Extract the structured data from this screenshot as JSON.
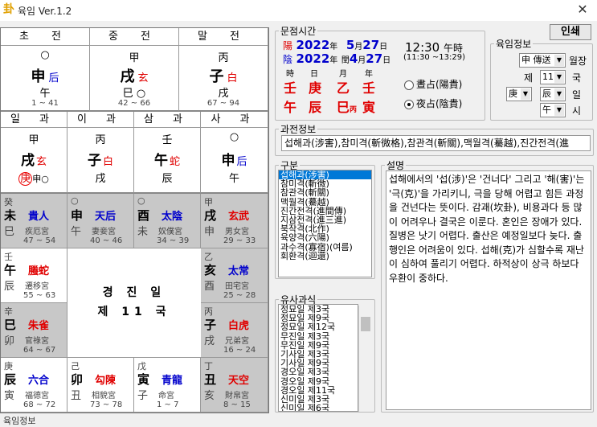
{
  "window": {
    "title": "육임 Ver.1.2",
    "close": "✕"
  },
  "top3": {
    "headers": [
      "초 전",
      "중 전",
      "말 전"
    ],
    "cells": [
      {
        "top": "○",
        "mid": "申",
        "midSmall": "后",
        "smallColor": "blue",
        "low": "午",
        "range": "1 ~ 41"
      },
      {
        "top": "甲",
        "mid": "戌",
        "midSmall": "玄",
        "smallColor": "red",
        "low": "巳 ○",
        "range": "42 ~ 66"
      },
      {
        "top": "丙",
        "mid": "子",
        "midSmall": "白",
        "smallColor": "red",
        "low": "戌",
        "range": "67 ~ 94"
      }
    ]
  },
  "four": {
    "headers": [
      "일 과",
      "이 과",
      "삼 과",
      "사 과"
    ],
    "cells": [
      {
        "a": "甲",
        "b": "戌",
        "bs": "玄",
        "bsColor": "red",
        "c": "庚",
        "cExtra": "申○"
      },
      {
        "a": "丙",
        "b": "子",
        "bs": "白",
        "bsColor": "red",
        "c": "戌",
        "cExtra": ""
      },
      {
        "a": "壬",
        "b": "午",
        "bs": "蛇",
        "bsColor": "red",
        "c": "辰",
        "cExtra": ""
      },
      {
        "a": "○",
        "b": "申",
        "bs": "后",
        "bsColor": "blue",
        "c": "午",
        "cExtra": ""
      }
    ]
  },
  "palaces": [
    {
      "r1": "癸",
      "k": "未",
      "g": "貴人",
      "gColor": "blue",
      "b2": "巳",
      "p": "疾厄宮",
      "rr": "47 ~ 54",
      "gray": true
    },
    {
      "r1": "○",
      "k": "申",
      "g": "天后",
      "gColor": "blue",
      "b2": "午",
      "p": "妻妾宮",
      "rr": "40 ~ 46",
      "gray": true
    },
    {
      "r1": "○",
      "k": "酉",
      "g": "太陰",
      "gColor": "blue",
      "b2": "未",
      "p": "奴僕宮",
      "rr": "34 ~ 39",
      "gray": true
    },
    {
      "r1": "甲",
      "k": "戌",
      "g": "玄武",
      "gColor": "red",
      "b2": "申",
      "p": "男女宮",
      "rr": "29 ~ 33",
      "gray": true
    },
    {
      "r1": "壬",
      "k": "午",
      "g": "螣蛇",
      "gColor": "red",
      "b2": "辰",
      "p": "遷移宮",
      "rr": "55 ~ 63",
      "gray": false
    },
    {
      "r1": "乙",
      "k": "亥",
      "g": "太常",
      "gColor": "blue",
      "b2": "酉",
      "p": "田宅宮",
      "rr": "25 ~ 28",
      "gray": true
    },
    {
      "r1": "辛",
      "k": "巳",
      "g": "朱雀",
      "gColor": "red",
      "b2": "卯",
      "p": "官祿宮",
      "rr": "64 ~ 67",
      "gray": true
    },
    {
      "r1": "丙",
      "k": "子",
      "g": "白虎",
      "gColor": "red",
      "b2": "戌",
      "p": "兄弟宮",
      "rr": "16 ~ 24",
      "gray": true
    },
    {
      "r1": "庚",
      "k": "辰",
      "g": "六合",
      "gColor": "blue",
      "b2": "寅",
      "p": "福德宮",
      "rr": "68 ~ 72",
      "gray": false
    },
    {
      "r1": "己",
      "k": "卯",
      "g": "勾陳",
      "gColor": "red",
      "b2": "丑",
      "p": "相貌宮",
      "rr": "73 ~ 78",
      "gray": false
    },
    {
      "r1": "戊",
      "k": "寅",
      "g": "青龍",
      "gColor": "blue",
      "b2": "子",
      "p": "命宮",
      "rr": "1 ~ 7",
      "gray": false
    },
    {
      "r1": "丁",
      "k": "丑",
      "g": "天空",
      "gColor": "red",
      "b2": "亥",
      "p": "財帛宮",
      "rr": "8 ~ 15",
      "gray": true
    }
  ],
  "center": {
    "line1": "경 진 일",
    "line2": "제 11 국"
  },
  "question_time": {
    "legend": "문점시간",
    "solar_label": "陽",
    "solar_year": "2022",
    "solar_month": "5",
    "solar_day": "27",
    "lunar_label": "陰",
    "lunar_year": "2022",
    "lunar_month": "4",
    "lunar_day": "27",
    "unit_year": "年",
    "unit_month": "月",
    "unit_day": "日",
    "leap": "閏",
    "time": "12:30",
    "time_unit": "午時",
    "time_range": "(11:30 ~13:29)",
    "headers": [
      "時",
      "日",
      "月",
      "年"
    ],
    "stems": [
      "壬",
      "庚",
      "乙",
      "壬"
    ],
    "branches": [
      "午",
      "辰",
      "巳",
      "寅"
    ],
    "branch_note": "丙",
    "radio_day": "晝占(陽貴)",
    "radio_night": "夜占(陰貴)",
    "selected": "night"
  },
  "print_button": "인쇄",
  "info": {
    "legend": "육임정보",
    "month_general": "申 傳送",
    "month_general_label": "월장",
    "ju_label_pre": "제",
    "ju_value": "11",
    "ju_label": "국",
    "day_stem": "庚",
    "day_branch": "辰",
    "day_label": "일",
    "hour_branch": "午",
    "hour_label": "시"
  },
  "gwa": {
    "legend": "과전정보",
    "text": "섭해과(涉害),참미격(斬微格),참관격(斬關),맥월격(驀越),진간전격(進"
  },
  "gubun": {
    "legend": "구분",
    "items": [
      "섭해과(涉害)",
      "참미격(斬微)",
      "참관격(斬關)",
      "맥월격(驀越)",
      "진간전격(進間傳)",
      "지삼전격(進三進)",
      "북작격(北作)",
      "육양격(六陽)",
      "과수격(寡宿)(여름)",
      "회환격(迴還)"
    ],
    "selected": 0
  },
  "seol": {
    "legend": "설명",
    "text": "섭해에서의 '섭(涉)'은 '건너다' 그리고 '해(害)'는 '극(克)'을 가리키니, 극을 당해 어렵고 힘든 과정을 건넌다는 뜻이다. 감괘(坎卦), 비용과다 등 많이 어려우나 결국은 이룬다. 혼인은 장애가 있다. 질병은 낫기 어렵다. 출산은 예정일보다 늦다. 출행인은 어려움이 있다. 섭해(克)가 심할수록 재난이 심하여 풀리기 어렵다. 하적상이 상극 하보다 우환이 중하다."
  },
  "yusa": {
    "legend": "유사과식",
    "items": [
      "정묘일 제3국",
      "정묘일 제9국",
      "정묘일 제12국",
      "무진일 제3국",
      "무진일 제9국",
      "기사일 제3국",
      "기사일 제9국",
      "경오일 제3국",
      "경오일 제9국",
      "경오일 제11국",
      "신미일 제3국",
      "신미일 제6국"
    ]
  },
  "status": "육임정보"
}
